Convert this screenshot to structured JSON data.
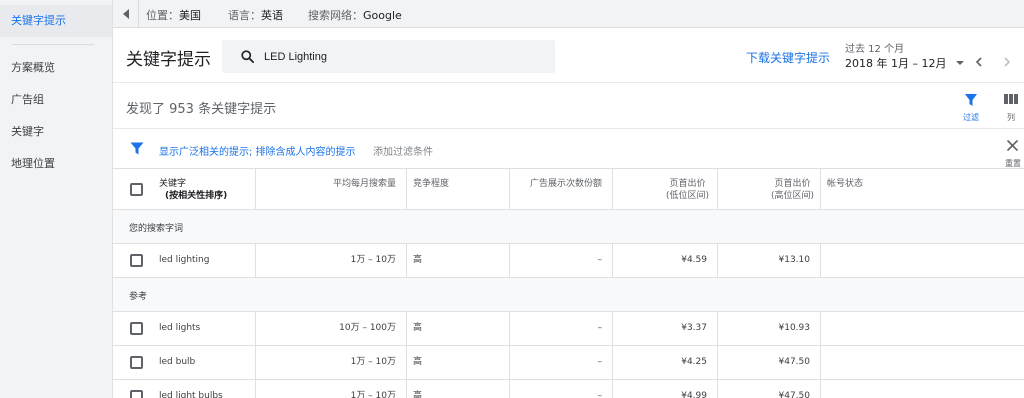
{
  "sidebar": {
    "items": [
      {
        "label": "关键字提示",
        "active": true
      },
      {
        "label": "方案概览"
      },
      {
        "label": "广告组"
      },
      {
        "label": "关键字"
      },
      {
        "label": "地理位置"
      }
    ]
  },
  "topbar": {
    "location_label": "位置：",
    "location_value": "美国",
    "language_label": "语言：",
    "language_value": "英语",
    "network_label": "搜索网络：",
    "network_value": "Google"
  },
  "header": {
    "title": "关键字提示",
    "search_value": "LED Lighting",
    "download_label": "下载关键字提示",
    "range_label": "过去 12 个月",
    "range_value": "2018 年 1月 – 12月"
  },
  "results": {
    "text": "发现了 953 条关键字提示",
    "filter_label": "过滤",
    "columns_label": "列"
  },
  "filter_bar": {
    "active_filters": "显示广泛相关的提示; 排除含成人内容的提示",
    "add_filter": "添加过滤条件",
    "reset_label": "重置"
  },
  "table": {
    "headers": {
      "keyword_line1": "关键字",
      "keyword_line2": "(按相关性排序)",
      "avg_searches": "平均每月搜索量",
      "competition": "竞争程度",
      "impression_share": "广告展示次数份额",
      "bid_low_line1": "页首出价",
      "bid_low_line2": "(低位区间)",
      "bid_high_line1": "页首出价",
      "bid_high_line2": "(高位区间)",
      "account_status": "帐号状态"
    },
    "section_yours": "您的搜索字词",
    "section_ref": "参考",
    "your_rows": [
      {
        "keyword": "led lighting",
        "searches": "1万 – 10万",
        "competition": "高",
        "share": "–",
        "bid_low": "¥4.59",
        "bid_high": "¥13.10"
      }
    ],
    "ref_rows": [
      {
        "keyword": "led lights",
        "searches": "10万 – 100万",
        "competition": "高",
        "share": "–",
        "bid_low": "¥3.37",
        "bid_high": "¥10.93"
      },
      {
        "keyword": "led bulb",
        "searches": "1万 – 10万",
        "competition": "高",
        "share": "–",
        "bid_low": "¥4.25",
        "bid_high": "¥47.50"
      },
      {
        "keyword": "led light bulbs",
        "searches": "1万 – 10万",
        "competition": "高",
        "share": "–",
        "bid_low": "¥4.99",
        "bid_high": "¥47.50"
      }
    ]
  },
  "colors": {
    "accent": "#1a73e8",
    "sidebar_bg": "#f1f3f4"
  }
}
